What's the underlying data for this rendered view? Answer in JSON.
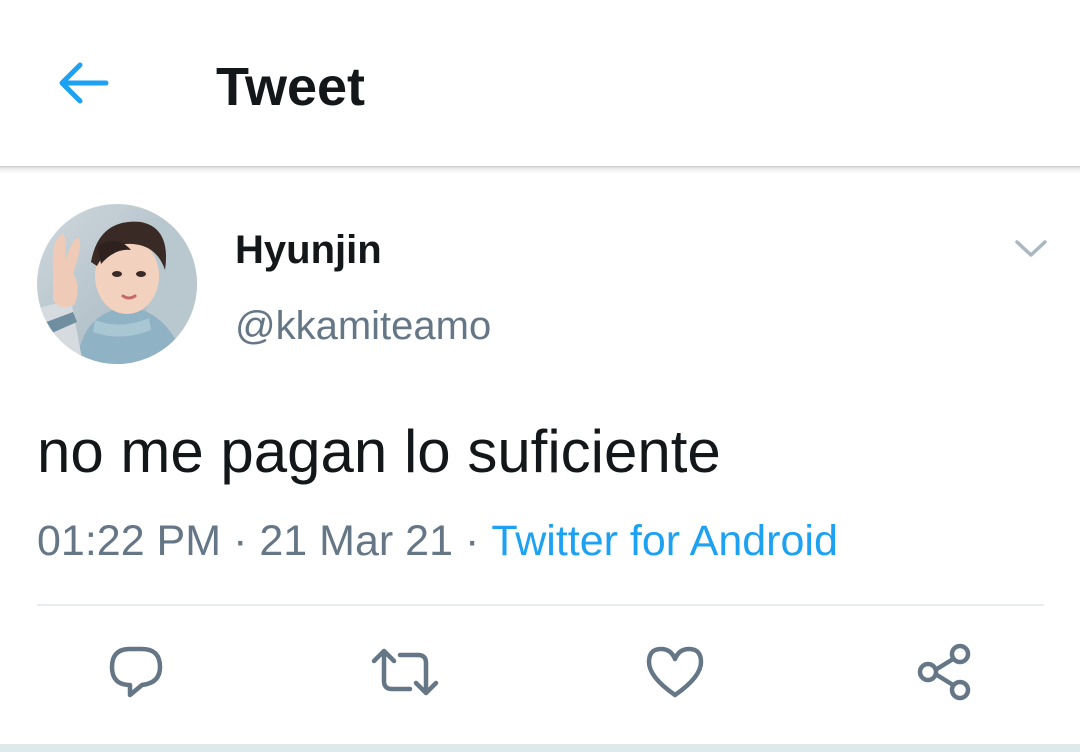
{
  "header": {
    "title": "Tweet",
    "back_icon": "arrow-left-icon"
  },
  "tweet": {
    "author": {
      "display_name": "Hyunjin",
      "handle": "@kkamiteamo"
    },
    "text": "no me pagan lo suficiente",
    "time": "01:22 PM",
    "date": "21 Mar 21",
    "separator": "·",
    "source": "Twitter for Android"
  },
  "actions": [
    {
      "name": "reply",
      "icon": "reply-icon"
    },
    {
      "name": "retweet",
      "icon": "retweet-icon"
    },
    {
      "name": "like",
      "icon": "heart-icon"
    },
    {
      "name": "share",
      "icon": "share-icon"
    }
  ],
  "colors": {
    "accent": "#1da1f2",
    "text_primary": "#14171a",
    "text_secondary": "#657786",
    "icon_gray": "#657786",
    "divider": "#e6ecf0"
  }
}
